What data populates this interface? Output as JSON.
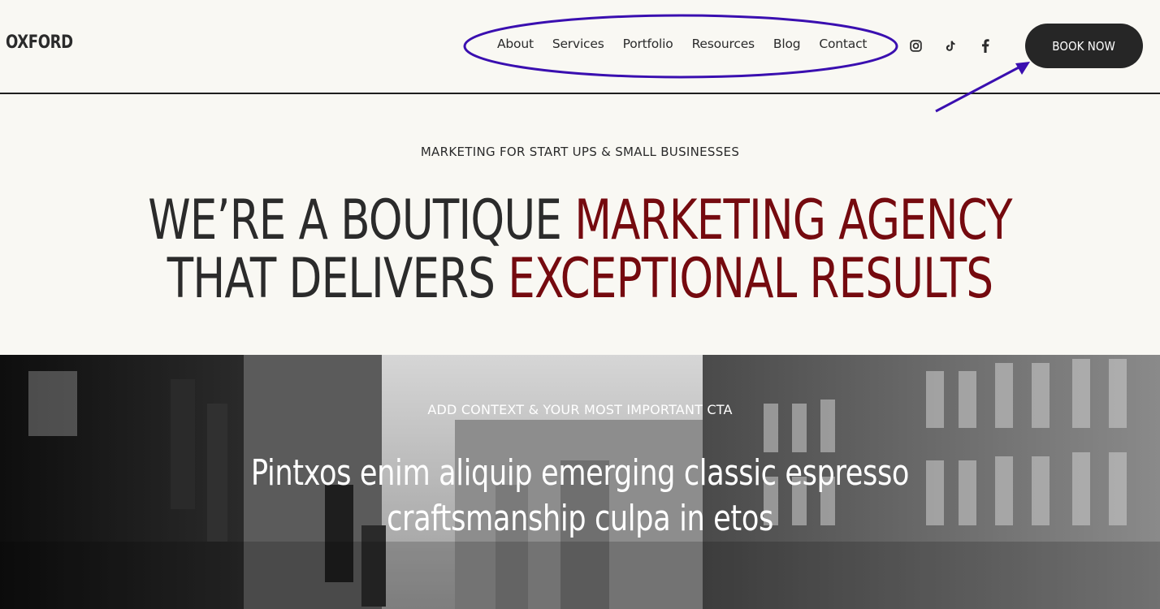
{
  "header": {
    "logo": "OXFORD",
    "nav": [
      {
        "label": "About"
      },
      {
        "label": "Services"
      },
      {
        "label": "Portfolio"
      },
      {
        "label": "Resources"
      },
      {
        "label": "Blog"
      },
      {
        "label": "Contact"
      }
    ],
    "social_icons": [
      "instagram-icon",
      "tiktok-icon",
      "facebook-icon"
    ],
    "book_button": "BOOK NOW"
  },
  "hero": {
    "kicker": "MARKETING FOR START UPS & SMALL BUSINESSES",
    "headline_line1_dark": "WE’RE A BOUTIQUE ",
    "headline_line1_accent": "MARKETING AGENCY",
    "headline_line2_dark": "THAT DELIVERS ",
    "headline_line2_accent": "EXCEPTIONAL RESULTS"
  },
  "photo_section": {
    "cta_label": "ADD CONTEXT & YOUR MOST IMPORTANT CTA",
    "headline_line1": "Pintxos enim aliquip emerging classic espresso",
    "headline_line2": "craftsmanship culpa in etos"
  },
  "annotations": {
    "color": "#3a0fb0"
  },
  "colors": {
    "background": "#f9f8f3",
    "text": "#2b2b2b",
    "accent": "#750a0f",
    "button": "#262626"
  }
}
